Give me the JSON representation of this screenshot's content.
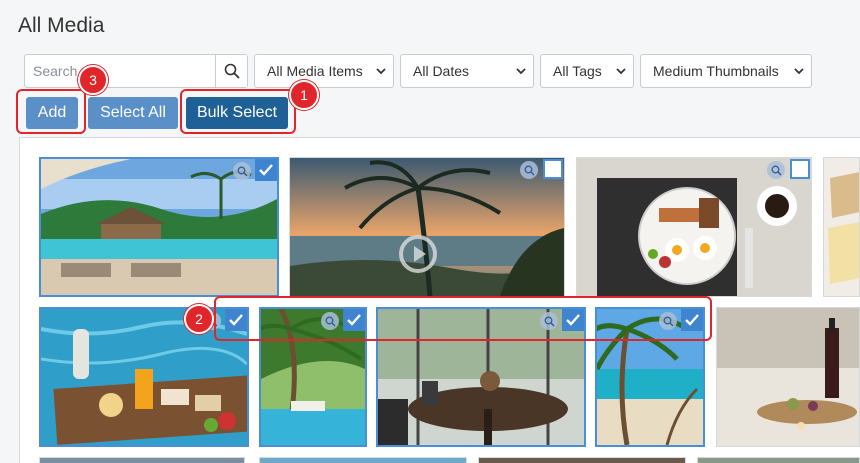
{
  "page": {
    "title": "All Media"
  },
  "search": {
    "placeholder": "Search"
  },
  "filters": {
    "media_type": "All Media Items",
    "dates": "All Dates",
    "tags": "All Tags",
    "size": "Medium Thumbnails"
  },
  "buttons": {
    "add": "Add",
    "select_all": "Select All",
    "bulk_select": "Bulk Select"
  },
  "callouts": {
    "one": "1",
    "two": "2",
    "three": "3"
  },
  "media": [
    {
      "name": "pool-resort",
      "selected": true
    },
    {
      "name": "palm-sunset-video",
      "selected": false,
      "video": true
    },
    {
      "name": "breakfast-plate",
      "selected": false
    },
    {
      "name": "cheese-crackers",
      "selected": false
    },
    {
      "name": "breakfast-tray-pool",
      "selected": true
    },
    {
      "name": "palm-pool",
      "selected": true
    },
    {
      "name": "cafe-table",
      "selected": true
    },
    {
      "name": "palm-beach",
      "selected": true
    },
    {
      "name": "wine-table",
      "selected": false
    }
  ],
  "colors": {
    "accent": "#3f84cf",
    "callout": "#e0262a",
    "button_dark": "#1f6196",
    "button_light": "#5a8fc8"
  }
}
